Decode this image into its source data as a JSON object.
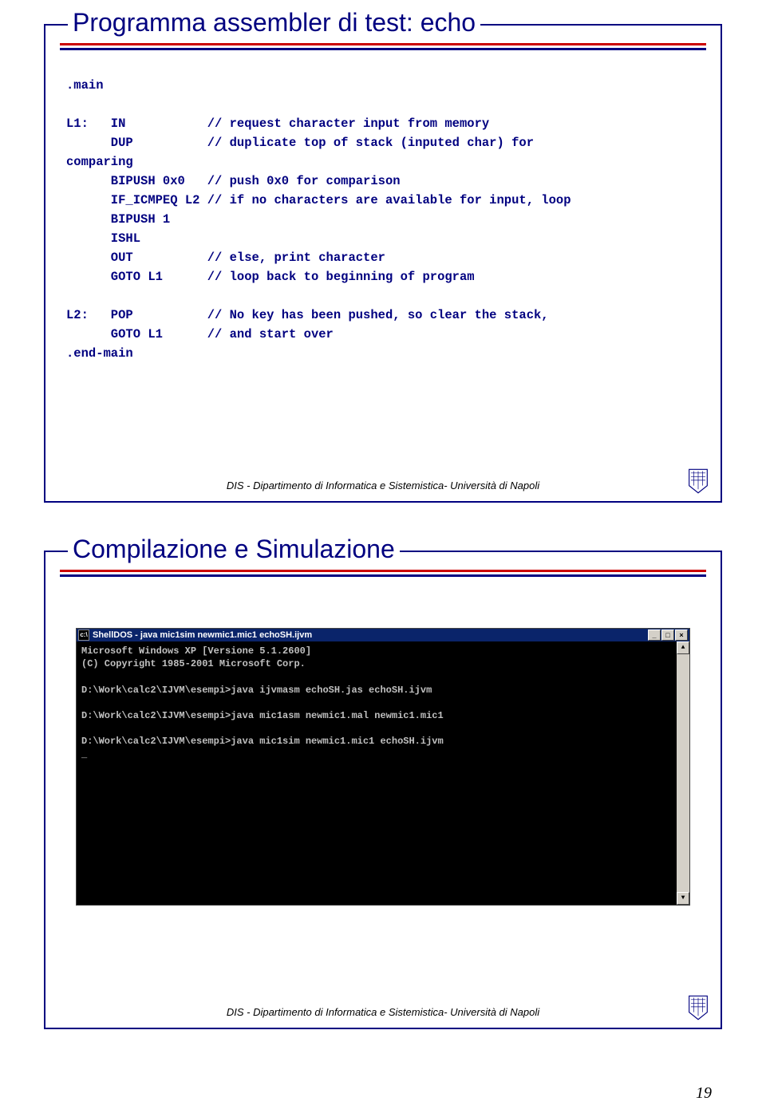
{
  "slide1": {
    "title": "Programma assembler di test: echo",
    "code": ".main\n\nL1:   IN           // request character input from memory\n      DUP          // duplicate top of stack (inputed char) for\ncomparing\n      BIPUSH 0x0   // push 0x0 for comparison\n      IF_ICMPEQ L2 // if no characters are available for input, loop\n      BIPUSH 1\n      ISHL\n      OUT          // else, print character\n      GOTO L1      // loop back to beginning of program\n\nL2:   POP          // No key has been pushed, so clear the stack,\n      GOTO L1      // and start over\n.end-main",
    "footer": "DIS - Dipartimento di Informatica e Sistemistica- Università di Napoli"
  },
  "slide2": {
    "title": "Compilazione e Simulazione",
    "cmd_title": "ShellDOS - java mic1sim newmic1.mic1 echoSH.ijvm",
    "cmd_min": "_",
    "cmd_max": "□",
    "cmd_close": "×",
    "cmd_body": "Microsoft Windows XP [Versione 5.1.2600]\n(C) Copyright 1985-2001 Microsoft Corp.\n\nD:\\Work\\calc2\\IJVM\\esempi>java ijvmasm echoSH.jas echoSH.ijvm\n\nD:\\Work\\calc2\\IJVM\\esempi>java mic1asm newmic1.mal newmic1.mic1\n\nD:\\Work\\calc2\\IJVM\\esempi>java mic1sim newmic1.mic1 echoSH.ijvm\n_",
    "scroll_up": "▲",
    "scroll_down": "▼",
    "footer": "DIS - Dipartimento di Informatica e Sistemistica- Università di Napoli"
  },
  "pagenum": "19"
}
